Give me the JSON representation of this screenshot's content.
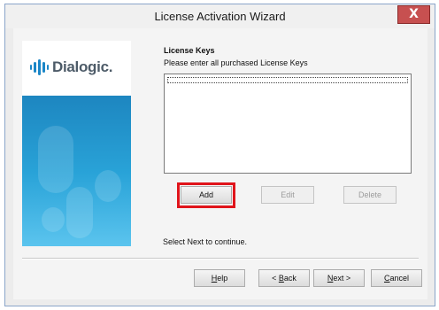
{
  "window": {
    "title": "License Activation Wizard",
    "close_label": "X"
  },
  "branding": {
    "logo_text": "Dialogic."
  },
  "main": {
    "heading": "License Keys",
    "subheading": "Please enter all purchased License Keys",
    "keys": [],
    "buttons": {
      "add": "Add",
      "edit": "Edit",
      "delete": "Delete"
    },
    "status": "Select Next to continue."
  },
  "footer": {
    "help_mnemonic": "H",
    "help_rest": "elp",
    "back_prefix": "< ",
    "back_mnemonic": "B",
    "back_rest": "ack",
    "next_mnemonic": "N",
    "next_rest": "ext >",
    "cancel_mnemonic": "C",
    "cancel_rest": "ancel"
  },
  "colors": {
    "highlight": "#e0141b",
    "brand_blue": "#1b86c7"
  }
}
